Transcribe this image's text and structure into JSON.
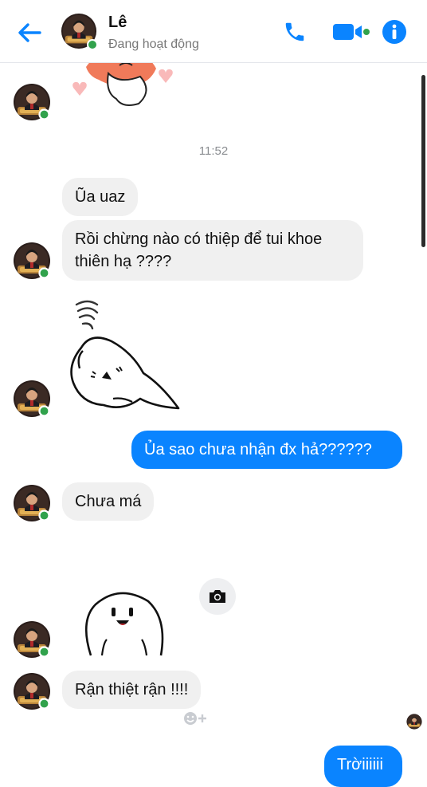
{
  "header": {
    "name": "Lê",
    "status": "Đang hoạt động",
    "icons": [
      "back-arrow-icon",
      "phone-icon",
      "video-call-icon",
      "info-icon"
    ]
  },
  "timestamp": "11:52",
  "messages": {
    "m1": "Ũa uaz",
    "m2_line1": "Rồi chừng nào có thiệp để tui khoe",
    "m2_line2": "thiên hạ ????",
    "m3": "Ủa sao chưa nhận đx hả??????",
    "m4": "Chưa má",
    "m5": "Rận thiệt rận !!!!",
    "m6": "Trờiiiiii"
  },
  "colors": {
    "accent": "#0a84ff",
    "incoming_bubble": "#f0f0f0",
    "online": "#31a24c"
  }
}
